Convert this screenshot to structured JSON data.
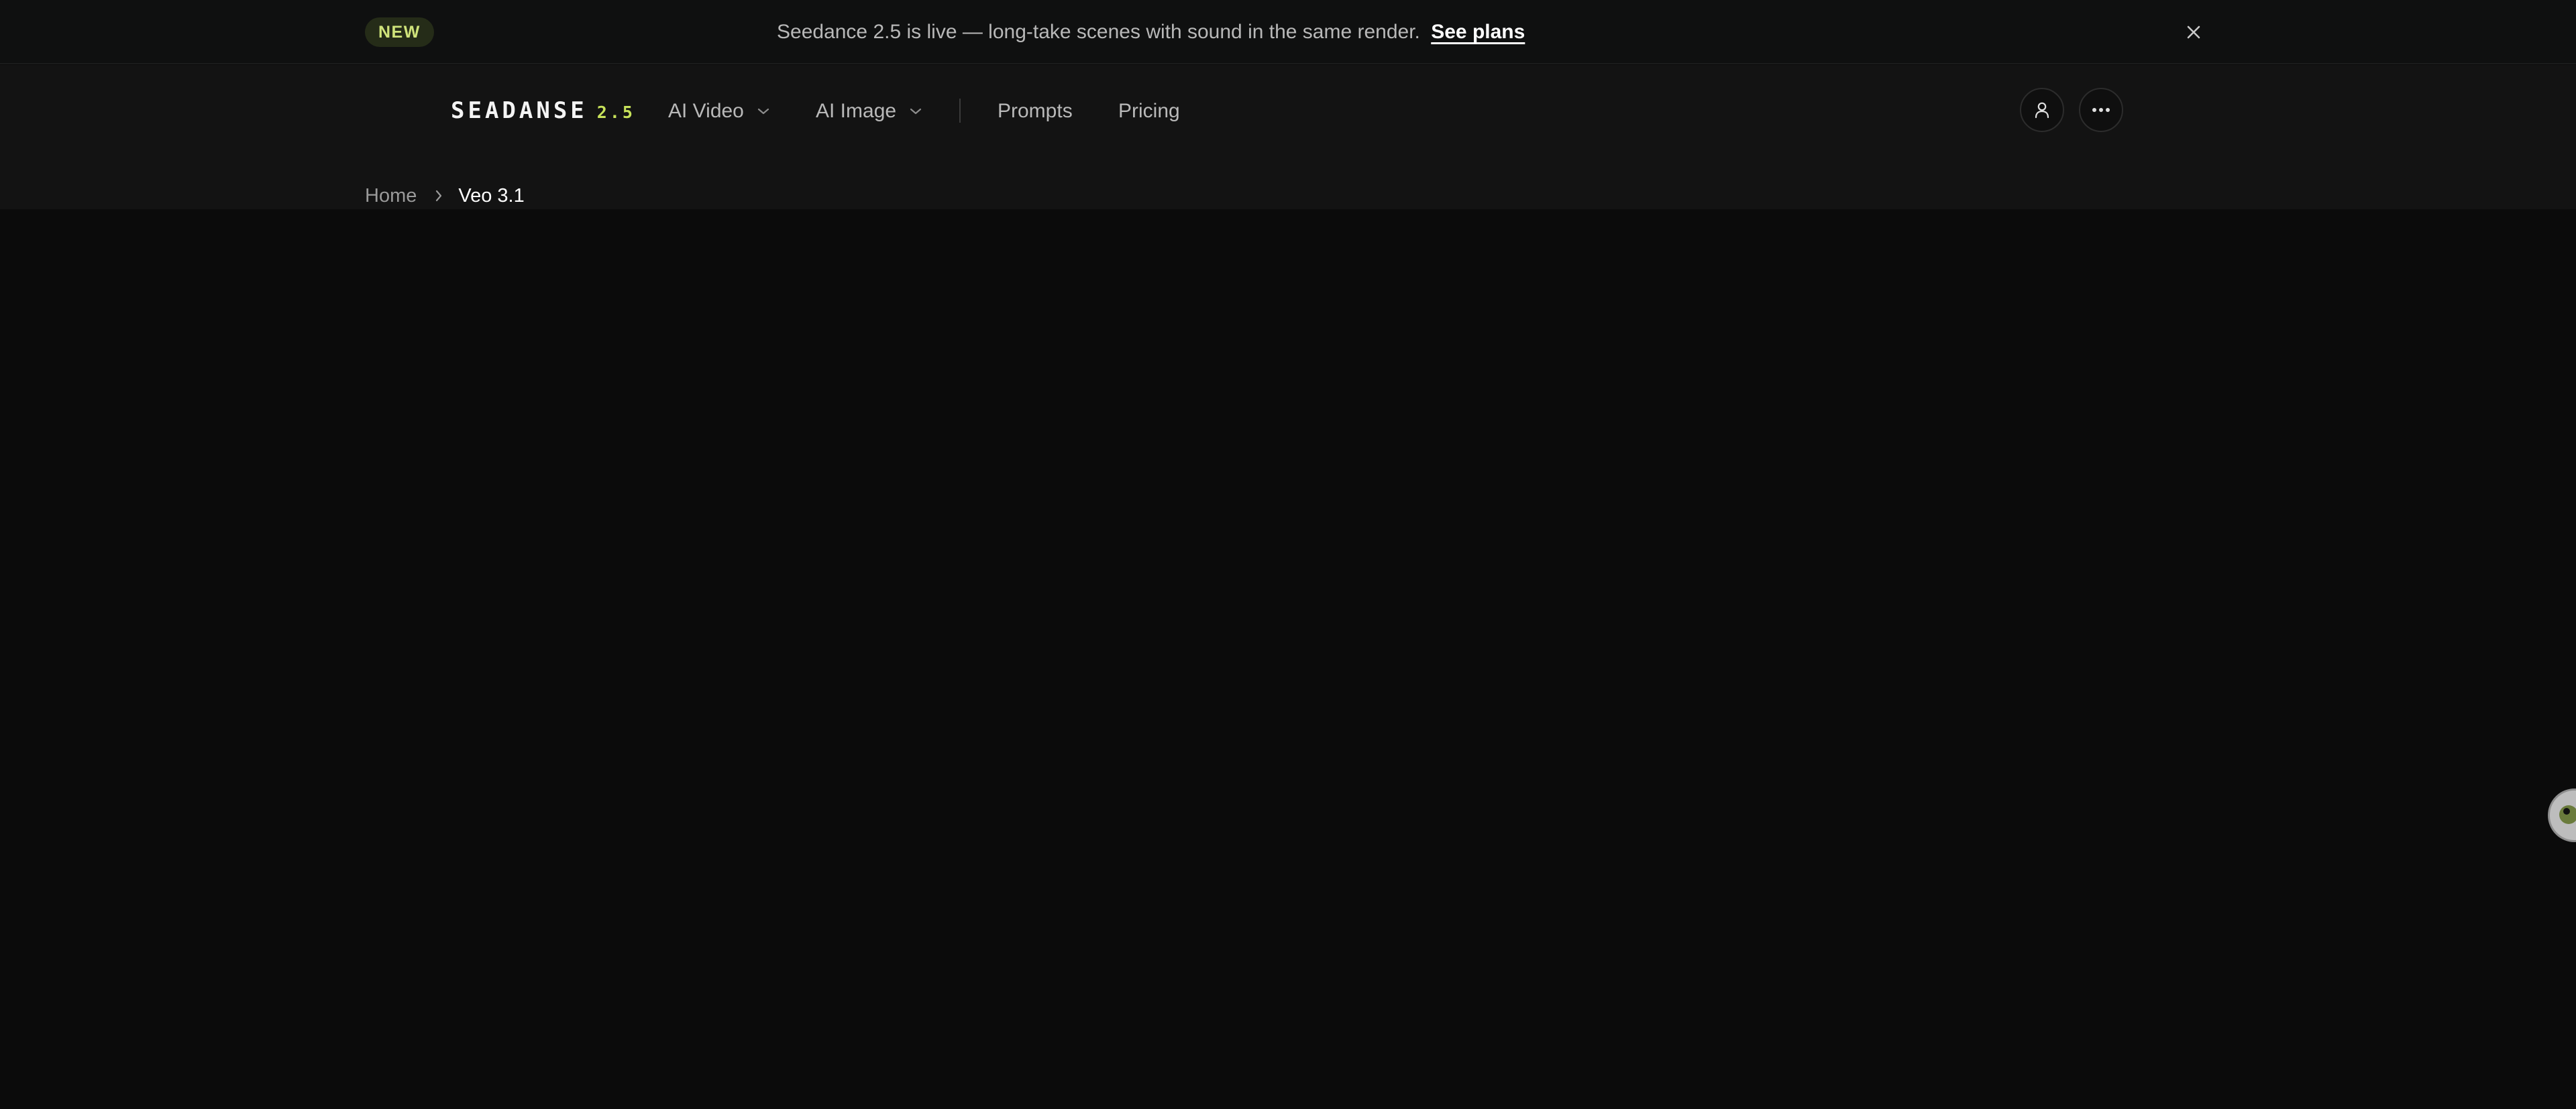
{
  "announcement": {
    "badge": "NEW",
    "text": "Seedance 2.5 is live — long-take scenes with sound in the same render.",
    "link_label": "See plans",
    "close_icon": "close-icon"
  },
  "header": {
    "logo": {
      "word": "SEADANSE",
      "version": "2.5"
    },
    "nav": {
      "ai_video": "AI Video",
      "ai_image": "AI Image",
      "prompts": "Prompts",
      "pricing": "Pricing"
    },
    "actions": {
      "account_icon": "user-icon",
      "more_icon": "more-icon"
    }
  },
  "breadcrumb": {
    "home": "Home",
    "current": "Veo 3.1"
  },
  "chat_widget": {
    "icon": "chat-avatar-icon"
  },
  "colors": {
    "accent": "#c7e25a",
    "badge_bg": "#252c18",
    "page_bg": "#0b0b0b",
    "header_bg": "#131313"
  }
}
